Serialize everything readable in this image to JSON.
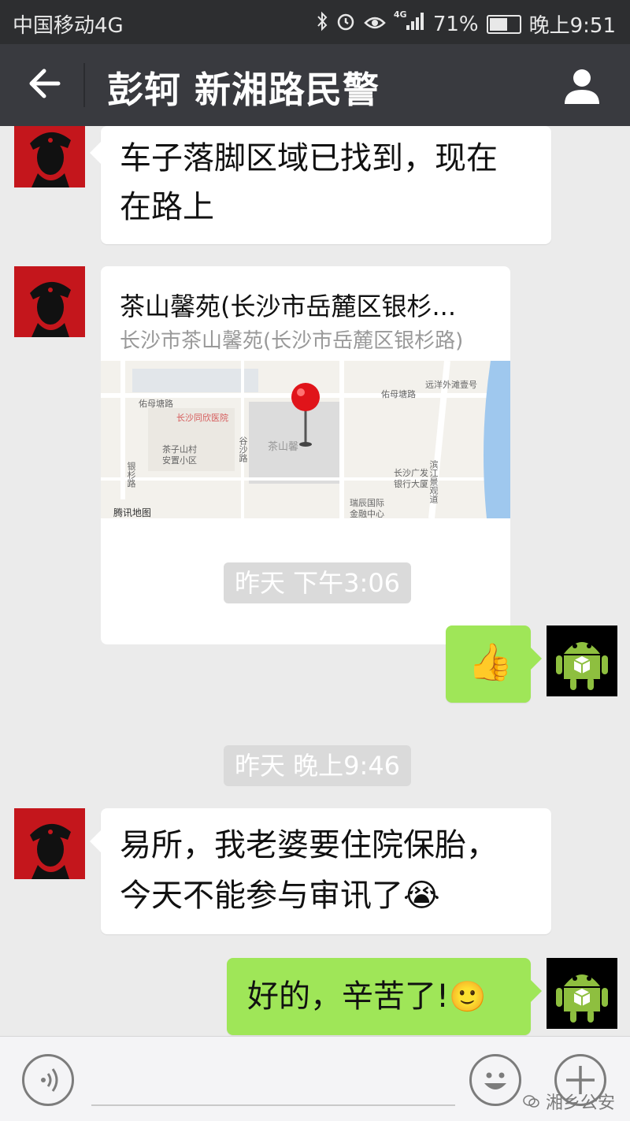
{
  "status_bar": {
    "carrier": "中国移动4G",
    "network_badge": "4G",
    "battery_percent": "71%",
    "battery_level": 0.71,
    "time": "晚上9:51"
  },
  "header": {
    "title": "彭轲 新湘路民警"
  },
  "messages": {
    "m1": {
      "sender": "contact",
      "text_line1": "车子落脚区域已找到，现在",
      "text_line2": "在路上"
    },
    "m2": {
      "sender": "contact",
      "location_title": "茶山馨苑(长沙市岳麓区银杉...",
      "location_address": "长沙市茶山馨苑(长沙市岳麓区银杉路)",
      "map_labels": {
        "provider": "腾讯地图",
        "street_1": "佑母塘路",
        "street_2": "佑母塘路",
        "hospital": "长沙同欣医院",
        "village": "茶子山村",
        "community": "安置小区",
        "road_1": "银杉路",
        "road_2": "谷沙路",
        "pin_place": "茶山馨",
        "bank": "长沙广发",
        "bank_2": "银行大厦",
        "finance": "瑞辰国际",
        "finance_2": "金融中心",
        "river_road": "滨江景观道",
        "top_right": "远洋外滩壹号"
      }
    },
    "t1": {
      "text": "昨天 下午3:06"
    },
    "m3": {
      "sender": "self",
      "emoji": "👍"
    },
    "t2": {
      "text": "昨天 晚上9:46"
    },
    "m4": {
      "sender": "contact",
      "text_line1": "易所，我老婆要住院保胎，",
      "text_line2": "今天不能参与审讯了",
      "emoji": "😭"
    },
    "m5": {
      "sender": "self",
      "text": "好的，辛苦了!",
      "emoji": "🙂"
    }
  },
  "input_bar": {
    "watermark": "湘乡公安"
  },
  "colors": {
    "status_bg": "#2d2e30",
    "nav_bg": "#393a3f",
    "chat_bg": "#ebebeb",
    "self_bubble": "#9fe658",
    "other_bubble": "#ffffff"
  }
}
